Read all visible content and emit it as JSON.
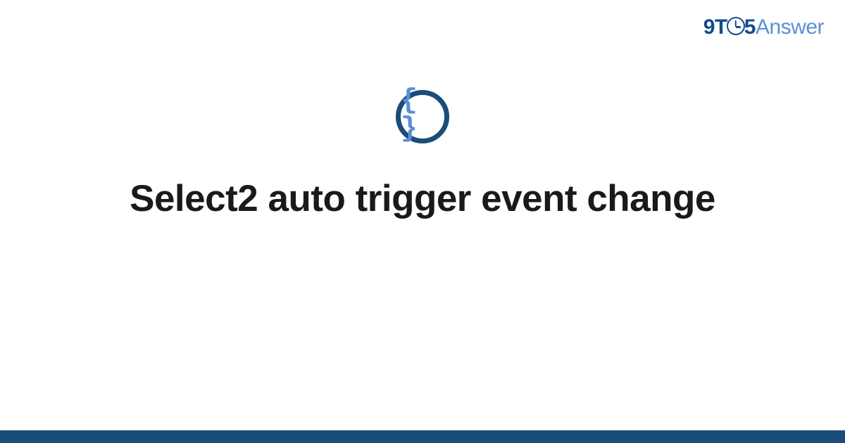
{
  "brand": {
    "part1": "9T",
    "part2": "5",
    "part3": "Answer"
  },
  "logo": {
    "symbol": "{ }"
  },
  "title": "Select2 auto trigger event change",
  "colors": {
    "brand_primary": "#144b8c",
    "brand_secondary": "#5a8fd4",
    "icon_border": "#1a4d7a",
    "bottom_bar": "#1a4d7a"
  }
}
